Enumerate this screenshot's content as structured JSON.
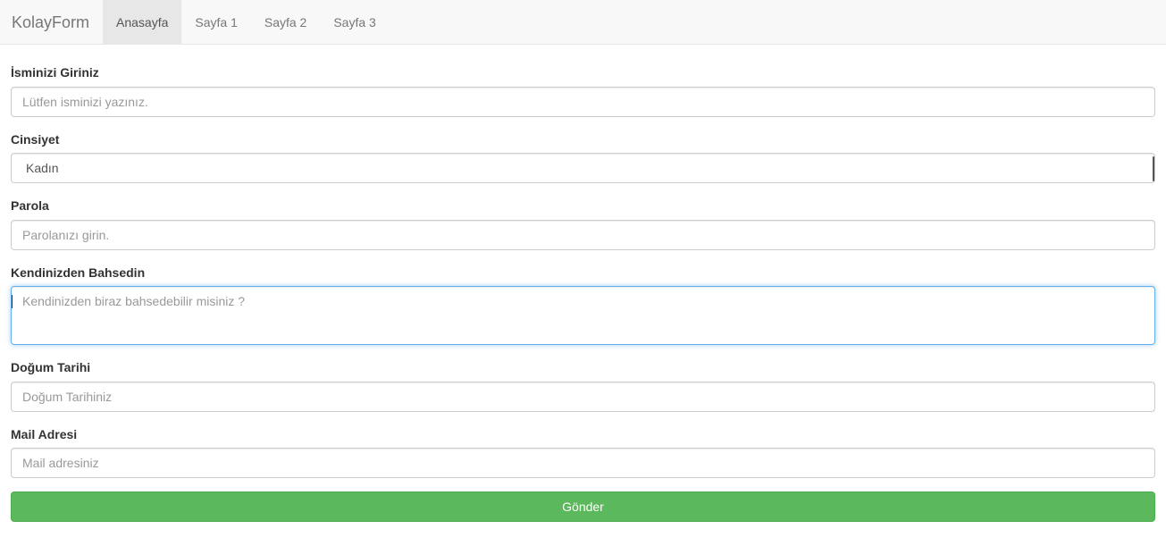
{
  "navbar": {
    "brand": "KolayForm",
    "tabs": [
      {
        "label": "Anasayfa",
        "active": true
      },
      {
        "label": "Sayfa 1",
        "active": false
      },
      {
        "label": "Sayfa 2",
        "active": false
      },
      {
        "label": "Sayfa 3",
        "active": false
      }
    ]
  },
  "form": {
    "name": {
      "label": "İsminizi Giriniz",
      "placeholder": "Lütfen isminizi yazınız.",
      "value": ""
    },
    "gender": {
      "label": "Cinsiyet",
      "selected": "Kadın"
    },
    "password": {
      "label": "Parola",
      "placeholder": "Parolanızı girin.",
      "value": ""
    },
    "about": {
      "label": "Kendinizden Bahsedin",
      "placeholder": "Kendinizden biraz bahsedebilir misiniz ?",
      "value": ""
    },
    "birthdate": {
      "label": "Doğum Tarihi",
      "placeholder": "Doğum Tarihiniz",
      "value": ""
    },
    "email": {
      "label": "Mail Adresi",
      "placeholder": "Mail adresiniz",
      "value": ""
    },
    "submit_label": "Gönder"
  },
  "colors": {
    "accent_green": "#5cb85c",
    "focus_blue": "#66afe9",
    "navbar_bg": "#f8f8f8"
  }
}
